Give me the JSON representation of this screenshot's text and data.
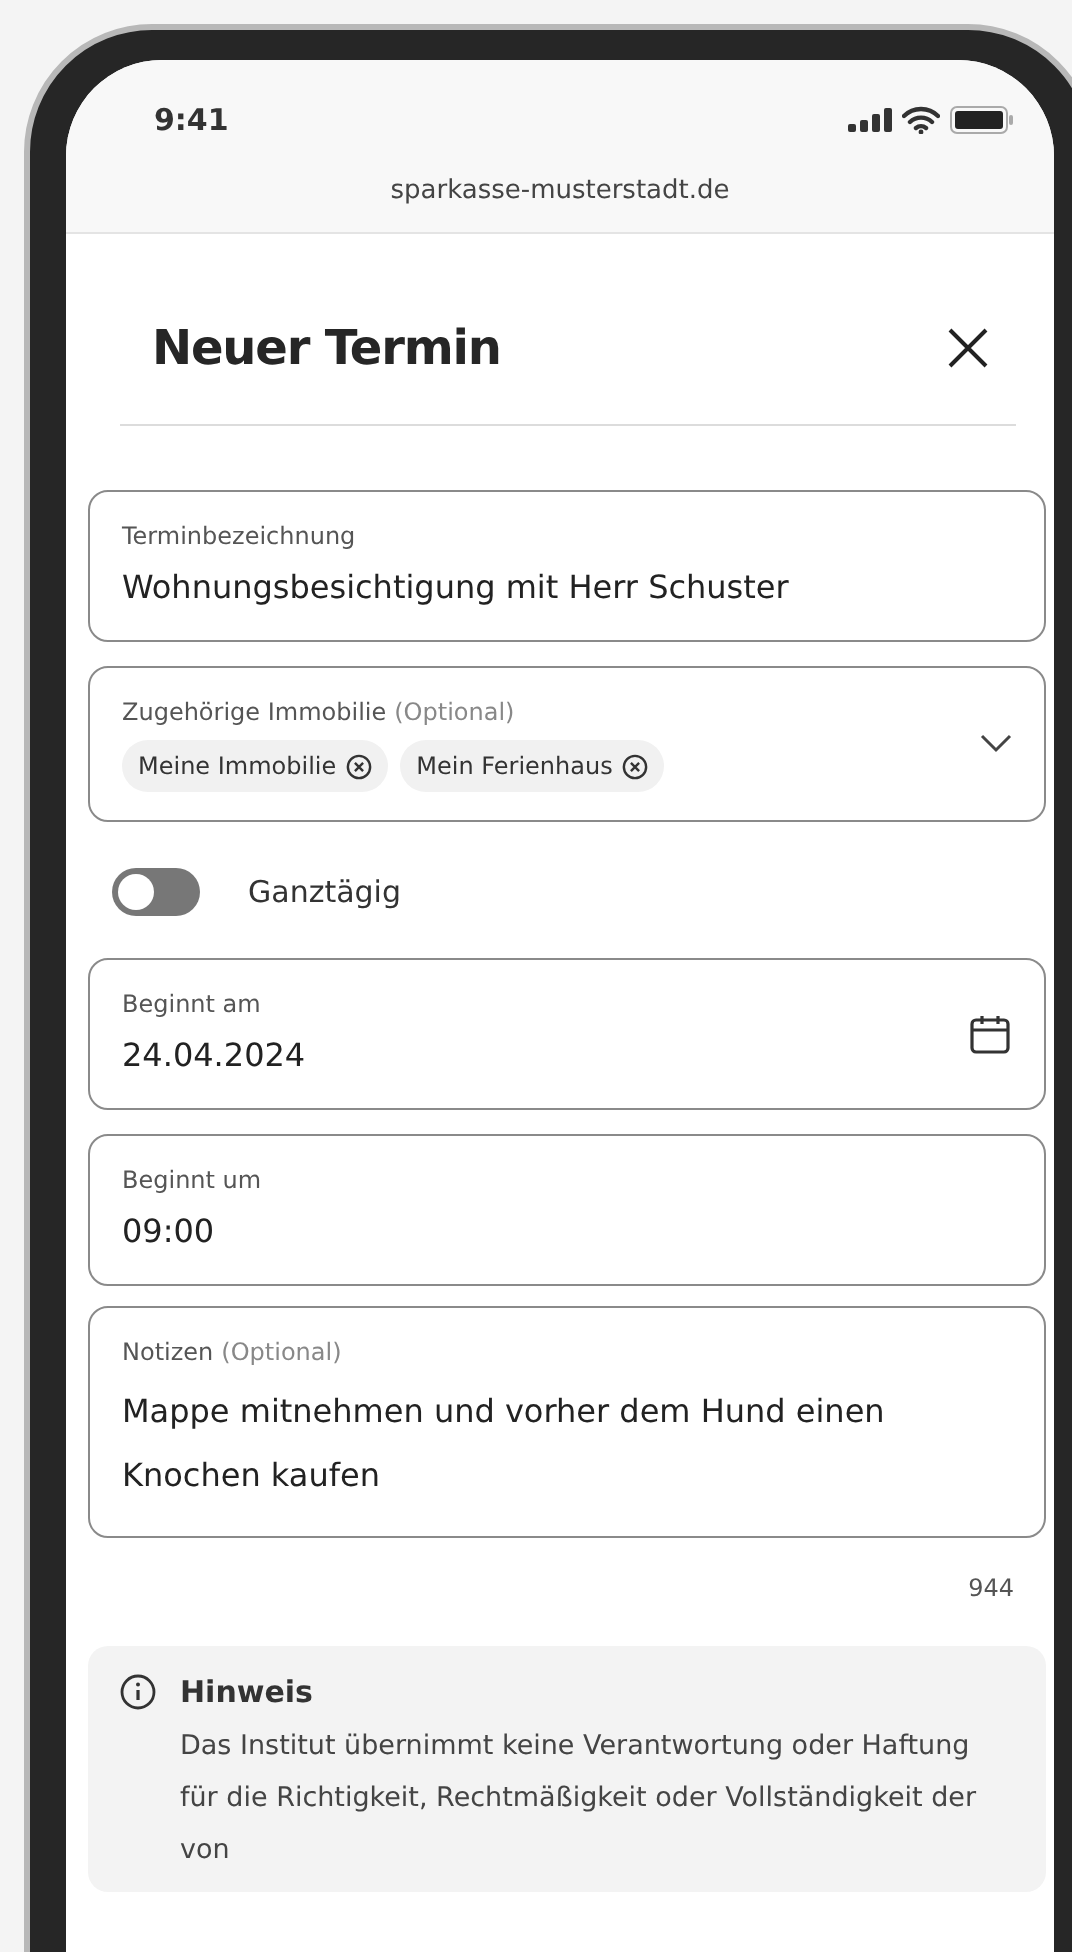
{
  "status_bar": {
    "time": "9:41"
  },
  "browser": {
    "url": "sparkasse-musterstadt.de"
  },
  "dialog": {
    "title": "Neuer Termin"
  },
  "title_field": {
    "label": "Terminbezeichnung",
    "value": "Wohnungsbesichtigung mit Herr Schuster"
  },
  "property_field": {
    "label": "Zugehörige Immobilie",
    "optional": "(Optional)",
    "chips": [
      "Meine Immobilie",
      "Mein Ferienhaus"
    ]
  },
  "all_day": {
    "label": "Ganztägig",
    "on": false
  },
  "start_date": {
    "label": "Beginnt am",
    "value": "24.04.2024"
  },
  "start_time": {
    "label": "Beginnt um",
    "value": "09:00"
  },
  "notes": {
    "label": "Notizen",
    "optional": "(Optional)",
    "value": "Mappe mitnehmen und vorher dem Hund einen Knochen kaufen",
    "counter": "944"
  },
  "notice": {
    "title": "Hinweis",
    "text": "Das Institut übernimmt keine Verantwortung oder Haftung für die Richtigkeit, Rechtmäßigkeit oder Vollständigkeit der von"
  }
}
